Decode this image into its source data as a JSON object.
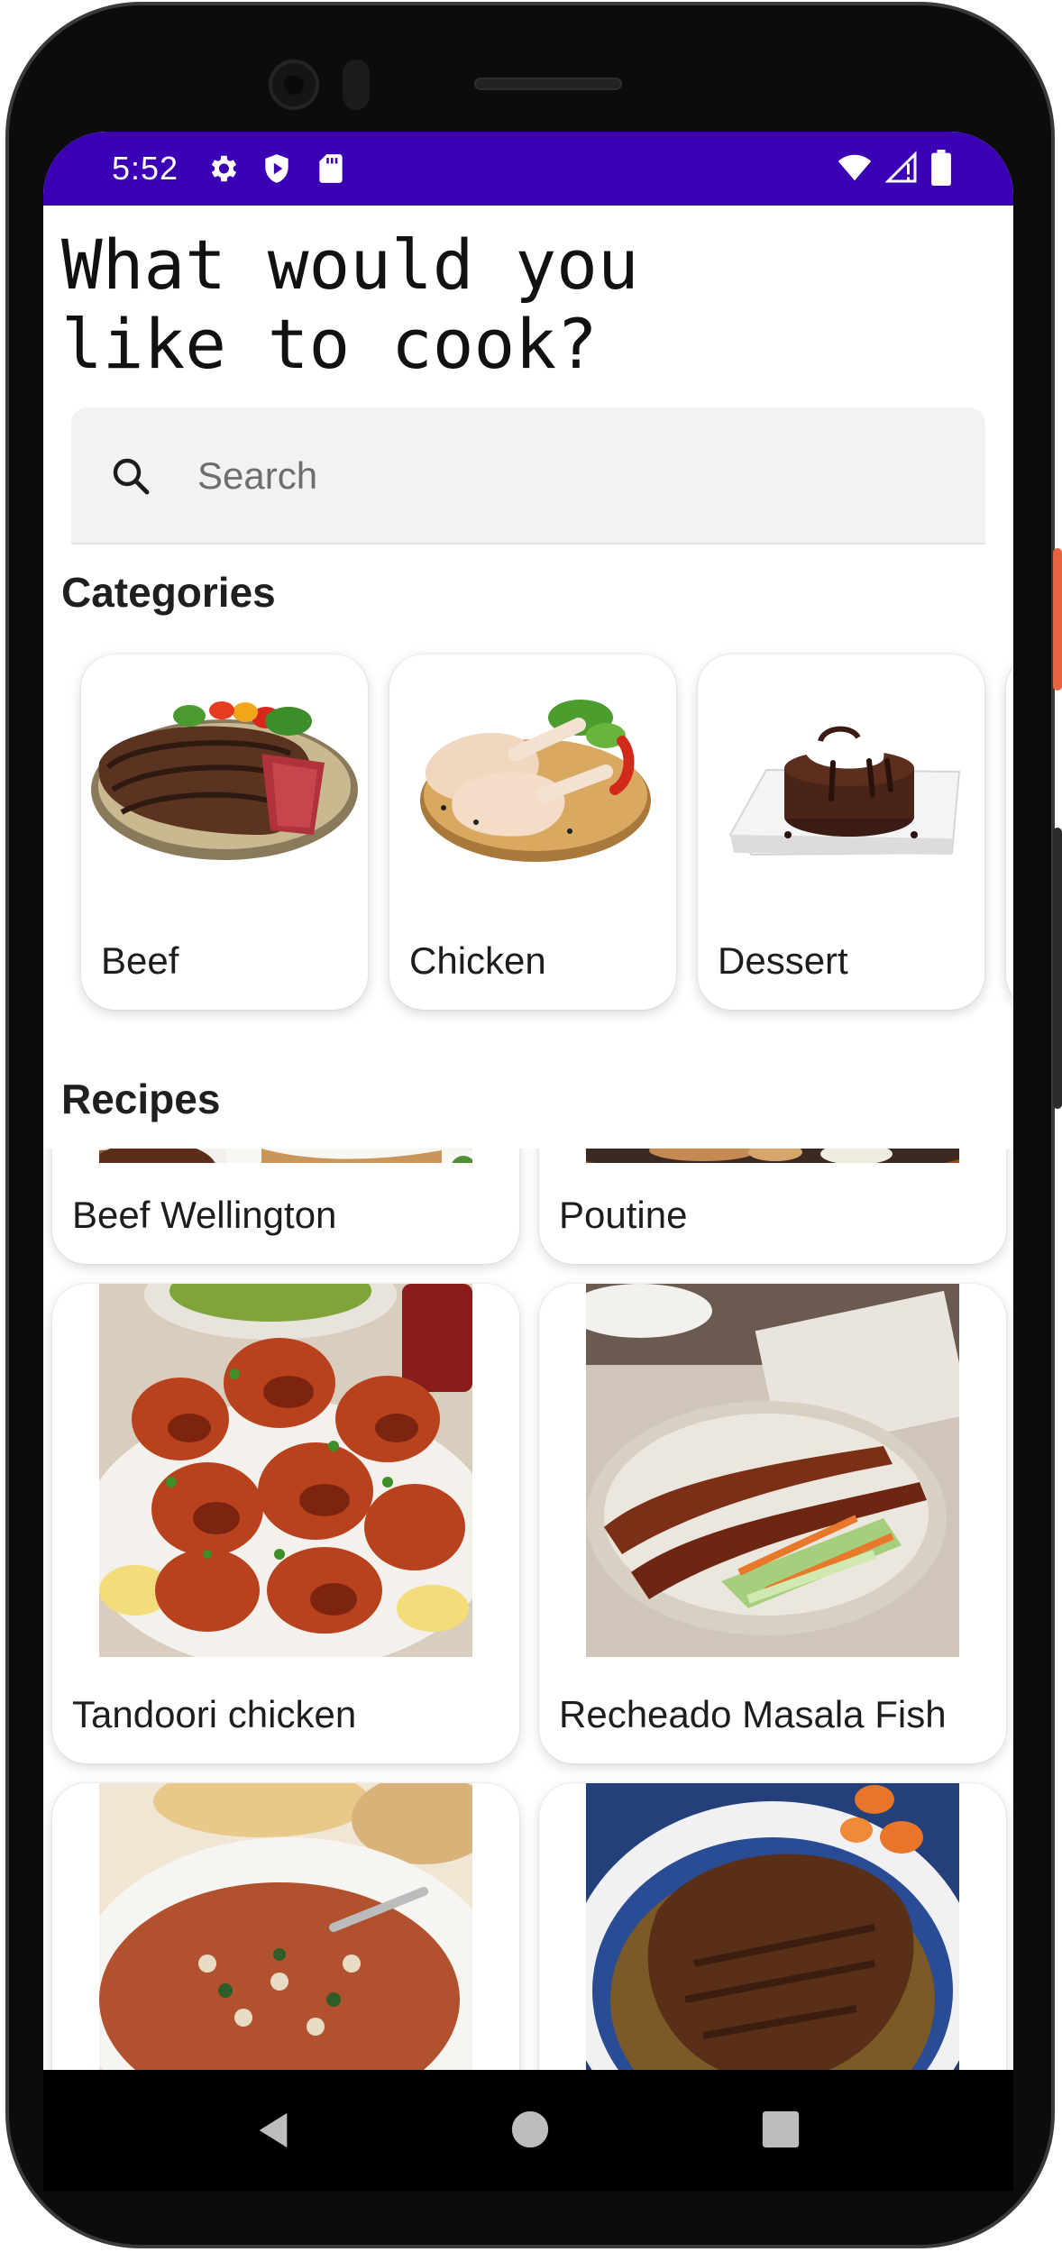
{
  "status_bar": {
    "time": "5:52",
    "background": "#3b00b4",
    "icons_left": [
      "settings-gear-icon",
      "shield-play-icon",
      "sd-card-icon"
    ],
    "icons_right": [
      "wifi-icon",
      "cell-signal-icon",
      "battery-icon"
    ]
  },
  "page": {
    "title": "What would you\nlike to cook?"
  },
  "search": {
    "placeholder": "Search",
    "value": ""
  },
  "categories": {
    "title": "Categories",
    "items": [
      {
        "label": "Beef",
        "icon": "beef-steak-image"
      },
      {
        "label": "Chicken",
        "icon": "chicken-legs-image"
      },
      {
        "label": "Dessert",
        "icon": "chocolate-cake-image"
      }
    ]
  },
  "recipes": {
    "title": "Recipes",
    "items": [
      {
        "label": "Beef Wellington"
      },
      {
        "label": "Poutine"
      },
      {
        "label": "Tandoori chicken"
      },
      {
        "label": "Recheado Masala Fish"
      },
      {
        "label": ""
      },
      {
        "label": ""
      }
    ]
  },
  "nav_bar": {
    "buttons": [
      "back-icon",
      "home-icon",
      "recents-icon"
    ]
  }
}
